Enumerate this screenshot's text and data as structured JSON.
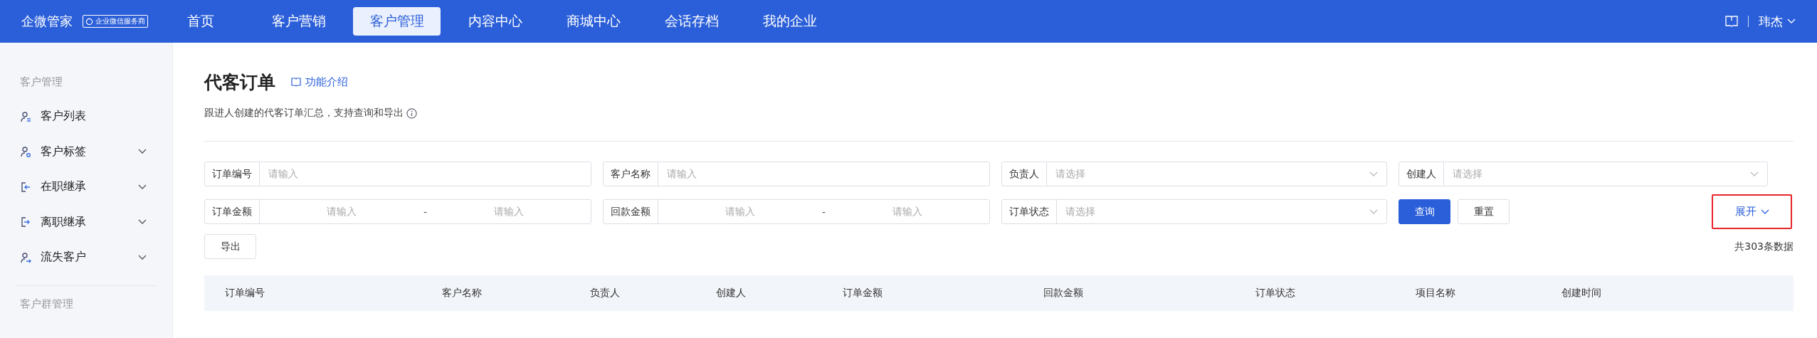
{
  "top_bar": {
    "brand": "企微管家",
    "badge": "企业微信服务商",
    "user": "玮杰",
    "nav": [
      {
        "label": "首页",
        "selected": false
      },
      {
        "label": "客户营销",
        "selected": false
      },
      {
        "label": "客户管理",
        "selected": true
      },
      {
        "label": "内容中心",
        "selected": false
      },
      {
        "label": "商城中心",
        "selected": false
      },
      {
        "label": "会话存档",
        "selected": false
      },
      {
        "label": "我的企业",
        "selected": false
      }
    ]
  },
  "sidebar": {
    "sections": [
      {
        "title": "客户管理",
        "items": [
          {
            "label": "客户列表",
            "kind": "list",
            "expandable": false
          },
          {
            "label": "客户标签",
            "kind": "tag",
            "expandable": true
          },
          {
            "label": "在职继承",
            "kind": "enter",
            "expandable": true
          },
          {
            "label": "离职继承",
            "kind": "exit",
            "expandable": true
          },
          {
            "label": "流失客户",
            "kind": "lost",
            "expandable": true
          }
        ]
      },
      {
        "title": "客户群管理"
      }
    ]
  },
  "page": {
    "title": "代客订单",
    "help_link": "功能介绍",
    "description": "跟进人创建的代客订单汇总，支持查询和导出"
  },
  "filters": [
    {
      "kind": "text",
      "label": "订单编号",
      "placeholder": "请输入"
    },
    {
      "kind": "text",
      "label": "客户名称",
      "placeholder": "请输入"
    },
    {
      "kind": "select",
      "label": "负责人",
      "placeholder": "请选择"
    },
    {
      "kind": "select",
      "label": "创建人",
      "placeholder": "请选择"
    },
    {
      "kind": "range",
      "label": "订单金额",
      "placeholder": "请输入",
      "placeholder_end": "请输入",
      "separator": "-"
    },
    {
      "kind": "range",
      "label": "回款金额",
      "placeholder": "请输入",
      "placeholder_end": "请输入",
      "separator": "-"
    },
    {
      "kind": "select",
      "label": "订单状态",
      "placeholder": "请选择"
    }
  ],
  "buttons": [
    {
      "label": "查询",
      "kind": "primary"
    },
    {
      "label": "重置",
      "kind": "default"
    }
  ],
  "expand": {
    "label": "展开",
    "highlighted": true
  },
  "export_button": "导出",
  "total": "共303条数据",
  "table": {
    "columns": [
      "订单编号",
      "客户名称",
      "负责人",
      "创建人",
      "订单金额",
      "回款金额",
      "订单状态",
      "项目名称",
      "创建时间"
    ]
  }
}
